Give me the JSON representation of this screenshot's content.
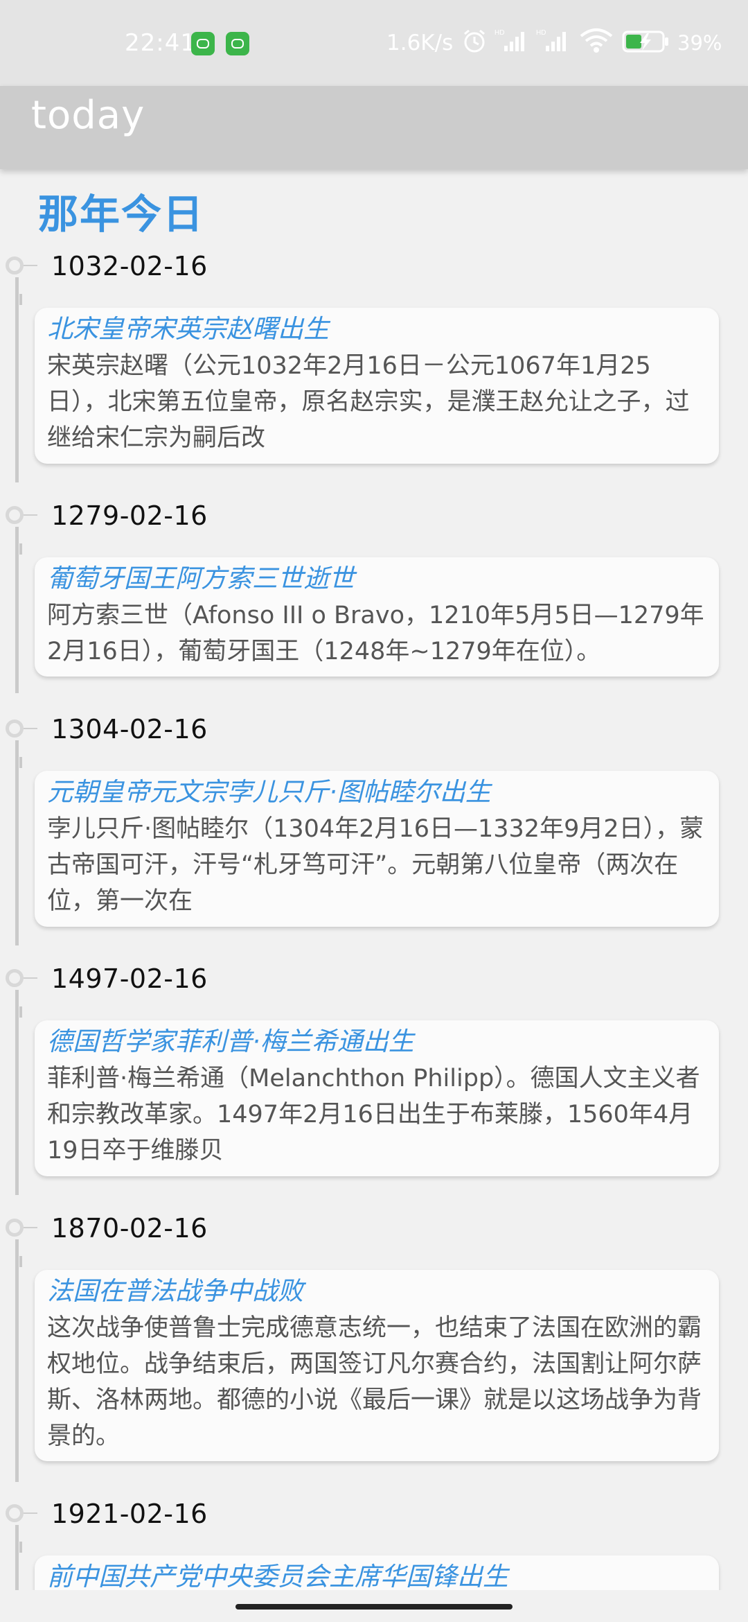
{
  "status_bar": {
    "time": "22:41",
    "net_speed": "1.6K/s",
    "battery_percent": "39%"
  },
  "app_bar": {
    "title": "today"
  },
  "heading": "那年今日",
  "events": [
    {
      "date": "1032-02-16",
      "title": "北宋皇帝宋英宗赵曙出生",
      "body": "宋英宗赵曙（公元1032年2月16日－公元1067年1月25日），北宋第五位皇帝，原名赵宗实，是濮王赵允让之子，过继给宋仁宗为嗣后改"
    },
    {
      "date": "1279-02-16",
      "title": "葡萄牙国王阿方索三世逝世",
      "body": "阿方索三世（Afonso III o Bravo，1210年5月5日—1279年2月16日），葡萄牙国王（1248年~1279年在位）。"
    },
    {
      "date": "1304-02-16",
      "title": "元朝皇帝元文宗孛儿只斤·图帖睦尔出生",
      "body": "孛儿只斤·图帖睦尔（1304年2月16日—1332年9月2日），蒙古帝国可汗，汗号“札牙笃可汗”。元朝第八位皇帝（两次在位，第一次在"
    },
    {
      "date": "1497-02-16",
      "title": "德国哲学家菲利普·梅兰希通出生",
      "body": "菲利普·梅兰希通（Melanchthon Philipp）。德国人文主义者和宗教改革家。1497年2月16日出生于布莱滕，1560年4月19日卒于维滕贝"
    },
    {
      "date": "1870-02-16",
      "title": "法国在普法战争中战败",
      "body": "这次战争使普鲁士完成德意志统一，也结束了法国在欧洲的霸权地位。战争结束后，两国签订凡尔赛合约，法国割让阿尔萨斯、洛林两地。都德的小说《最后一课》就是以这场战争为背景的。"
    },
    {
      "date": "1921-02-16",
      "title": "前中国共产党中央委员会主席华国锋出生",
      "body": ""
    }
  ],
  "icons": {
    "app_notification_1": "app-notification-icon",
    "app_notification_2": "app-notification-icon",
    "alarm": "alarm-icon",
    "signal_1": "signal-hd-icon",
    "signal_2": "signal-hd-icon",
    "wifi": "wifi-icon",
    "battery": "battery-charging-icon"
  },
  "colors": {
    "accent": "#3a93e0",
    "status_bar": "#e4e4e4",
    "app_bar": "#cccccc",
    "background": "#f1f1f1",
    "card": "#fbfbfb"
  }
}
